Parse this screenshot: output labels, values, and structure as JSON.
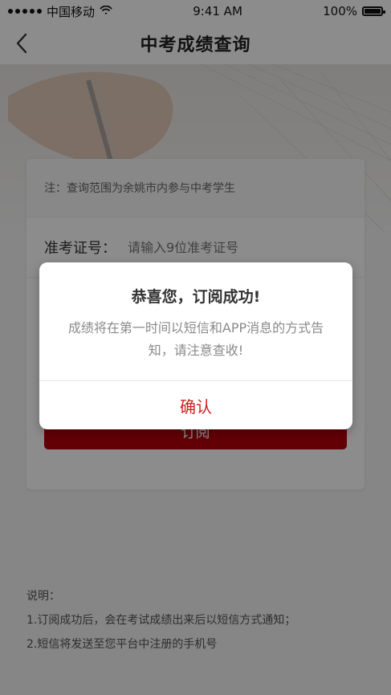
{
  "status_bar": {
    "carrier": "中国移动",
    "time": "9:41 AM",
    "battery": "100%",
    "icons": [
      "signal-dots-icon",
      "wifi-icon",
      "battery-icon"
    ]
  },
  "nav": {
    "title": "中考成绩查询",
    "back_icon": "chevron-left-icon"
  },
  "card": {
    "note": "注：查询范围为余姚市内参与中考学生",
    "field_label": "准考证号：",
    "input_placeholder": "请输入9位准考证号",
    "subscribe_label": "订阅"
  },
  "explain": {
    "title": "说明：",
    "items": [
      "1.订阅成功后，会在考试成绩出来后以短信方式通知；",
      "2.短信将发送至您平台中注册的手机号"
    ]
  },
  "modal": {
    "title": "恭喜您，订阅成功!",
    "message": "成绩将在第一时间以短信和APP消息的方式告知，请注意查收!",
    "confirm_label": "确认"
  },
  "colors": {
    "accent": "#b3000b",
    "confirm_text": "#d01d1d"
  }
}
